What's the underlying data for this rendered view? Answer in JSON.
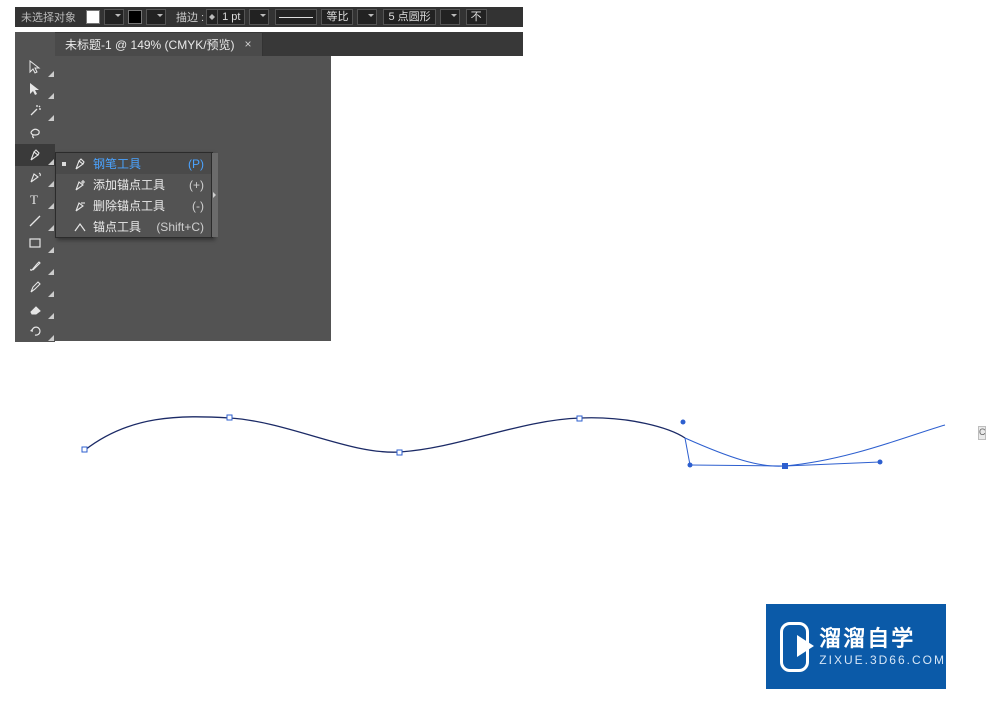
{
  "topbar": {
    "selection_label": "未选择对象",
    "stroke_label": "描边 :",
    "stroke_value": "1 pt",
    "ratio_label": "等比",
    "corner_value": "5 点圆形",
    "opacity_trunc": "不"
  },
  "tab": {
    "title": "未标题-1 @ 149% (CMYK/预览)",
    "close": "×"
  },
  "flyout": {
    "items": [
      {
        "label": "钢笔工具",
        "shortcut": "(P)",
        "selected": true
      },
      {
        "label": "添加锚点工具",
        "shortcut": "(+)",
        "selected": false
      },
      {
        "label": "删除锚点工具",
        "shortcut": "(-)",
        "selected": false
      },
      {
        "label": "锚点工具",
        "shortcut": "(Shift+C)",
        "selected": false
      }
    ]
  },
  "watermark": {
    "line1": "溜溜自学",
    "line2": "ZIXUE.3D66.COM"
  },
  "edge_mark": "C"
}
